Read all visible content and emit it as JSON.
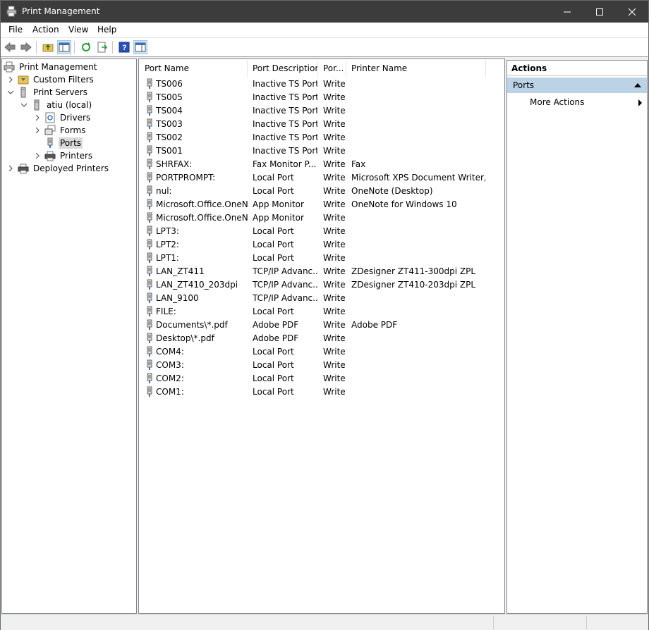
{
  "window": {
    "title": "Print Management"
  },
  "menu": [
    "File",
    "Action",
    "View",
    "Help"
  ],
  "tree": [
    {
      "label": "Print Management",
      "icon": "print-management-icon",
      "expander": "none"
    },
    {
      "label": "Custom Filters",
      "icon": "filter-folder-icon",
      "expander": "collapsed"
    },
    {
      "label": "Print Servers",
      "icon": "server-icon",
      "expander": "expanded"
    },
    {
      "label": "atiu (local)",
      "icon": "server-icon",
      "expander": "expanded"
    },
    {
      "label": "Drivers",
      "icon": "drivers-icon",
      "expander": "collapsed"
    },
    {
      "label": "Forms",
      "icon": "forms-icon",
      "expander": "collapsed"
    },
    {
      "label": "Ports",
      "icon": "port-icon",
      "expander": "none",
      "selected": true
    },
    {
      "label": "Printers",
      "icon": "printer-icon",
      "expander": "collapsed"
    },
    {
      "label": "Deployed Printers",
      "icon": "printer-icon",
      "expander": "collapsed"
    }
  ],
  "list": {
    "columns": [
      "Port Name",
      "Port Description",
      "Por...",
      "Printer Name"
    ],
    "rows": [
      [
        "TS006",
        "Inactive TS Port",
        "Write",
        ""
      ],
      [
        "TS005",
        "Inactive TS Port",
        "Write",
        ""
      ],
      [
        "TS004",
        "Inactive TS Port",
        "Write",
        ""
      ],
      [
        "TS003",
        "Inactive TS Port",
        "Write",
        ""
      ],
      [
        "TS002",
        "Inactive TS Port",
        "Write",
        ""
      ],
      [
        "TS001",
        "Inactive TS Port",
        "Write",
        ""
      ],
      [
        "SHRFAX:",
        "Fax Monitor P...",
        "Write",
        "Fax"
      ],
      [
        "PORTPROMPT:",
        "Local Port",
        "Write",
        "Microsoft XPS Document Writer,..."
      ],
      [
        "nul:",
        "Local Port",
        "Write",
        "OneNote (Desktop)"
      ],
      [
        "Microsoft.Office.OneN...",
        "App Monitor",
        "Write",
        "OneNote for Windows 10"
      ],
      [
        "Microsoft.Office.OneN...",
        "App Monitor",
        "Write",
        ""
      ],
      [
        "LPT3:",
        "Local Port",
        "Write",
        ""
      ],
      [
        "LPT2:",
        "Local Port",
        "Write",
        ""
      ],
      [
        "LPT1:",
        "Local Port",
        "Write",
        ""
      ],
      [
        "LAN_ZT411",
        "TCP/IP Advanc...",
        "Write",
        "ZDesigner ZT411-300dpi ZPL"
      ],
      [
        "LAN_ZT410_203dpi",
        "TCP/IP Advanc...",
        "Write",
        "ZDesigner ZT410-203dpi ZPL"
      ],
      [
        "LAN_9100",
        "TCP/IP Advanc...",
        "Write",
        ""
      ],
      [
        "FILE:",
        "Local Port",
        "Write",
        ""
      ],
      [
        "Documents\\*.pdf",
        "Adobe PDF",
        "Write",
        "Adobe PDF"
      ],
      [
        "Desktop\\*.pdf",
        "Adobe PDF",
        "Write",
        ""
      ],
      [
        "COM4:",
        "Local Port",
        "Write",
        ""
      ],
      [
        "COM3:",
        "Local Port",
        "Write",
        ""
      ],
      [
        "COM2:",
        "Local Port",
        "Write",
        ""
      ],
      [
        "COM1:",
        "Local Port",
        "Write",
        ""
      ]
    ]
  },
  "actions": {
    "header": "Actions",
    "section": "Ports",
    "items": [
      "More Actions"
    ]
  },
  "colors": {
    "titlebar": "#3c3c3c",
    "selection": "#d9d9d9",
    "actions_section": "#bcd2e6"
  }
}
